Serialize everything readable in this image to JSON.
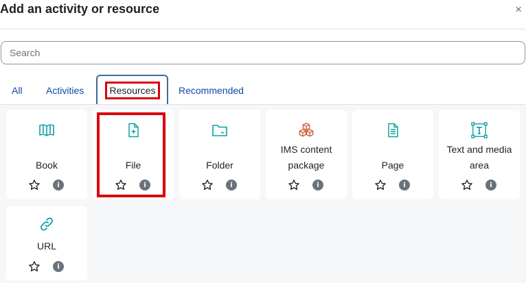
{
  "dialog": {
    "title": "Add an activity or resource",
    "close_symbol": "×"
  },
  "search": {
    "placeholder": "Search",
    "value": ""
  },
  "tabs": [
    {
      "label": "All",
      "active": false
    },
    {
      "label": "Activities",
      "active": false
    },
    {
      "label": "Resources",
      "active": true
    },
    {
      "label": "Recommended",
      "active": false
    }
  ],
  "items": [
    {
      "name": "Book",
      "icon": "book-icon",
      "starred": false
    },
    {
      "name": "File",
      "icon": "file-add-icon",
      "starred": false
    },
    {
      "name": "Folder",
      "icon": "folder-icon",
      "starred": false
    },
    {
      "name": "IMS content package",
      "name_line1": "IMS content",
      "name_line2": "package",
      "icon": "cubes-icon",
      "starred": false
    },
    {
      "name": "Page",
      "icon": "page-icon",
      "starred": false
    },
    {
      "name": "Text and media area",
      "name_line1": "Text and media",
      "name_line2": "area",
      "icon": "text-media-icon",
      "starred": false
    },
    {
      "name": "URL",
      "icon": "link-icon",
      "starred": false
    }
  ],
  "info_symbol": "i",
  "colors": {
    "resource_icon": "#0d9fa3",
    "package_icon": "#c3592b",
    "link_color": "#0f47ad",
    "highlight": "#d9000d",
    "tab_outline": "#3c6a96"
  }
}
